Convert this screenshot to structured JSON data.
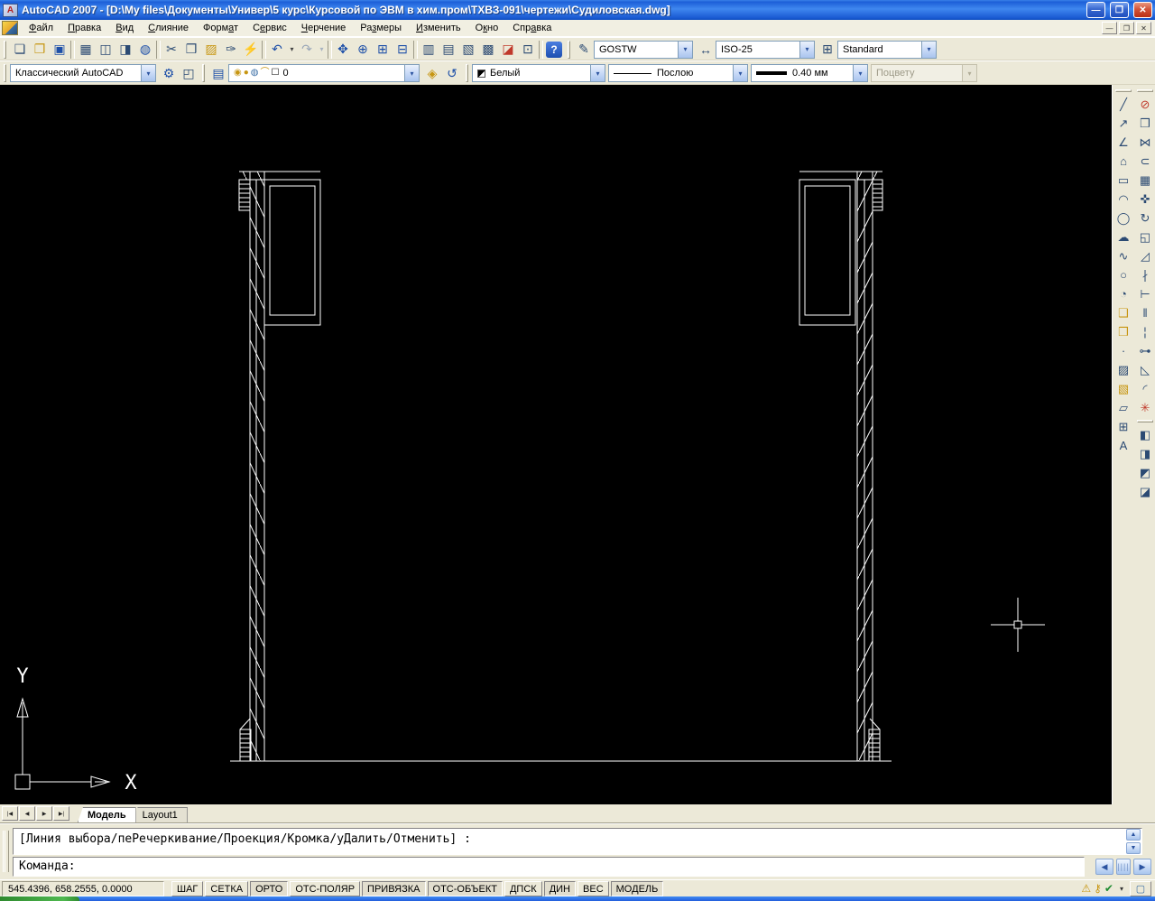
{
  "window": {
    "title": "AutoCAD 2007 - [D:\\My files\\Документы\\Универ\\5 курс\\Курсовой по ЭВМ в хим.пром\\ТХВЗ-091\\чертежи\\Судиловская.dwg]"
  },
  "controls": {
    "min": "—",
    "restore": "❐",
    "close": "✕"
  },
  "menu": {
    "items": [
      {
        "name": "menu-file",
        "label": "Файл",
        "u": 0
      },
      {
        "name": "menu-edit",
        "label": "Правка",
        "u": 0
      },
      {
        "name": "menu-view",
        "label": "Вид",
        "u": 0
      },
      {
        "name": "menu-merge",
        "label": "Слияние",
        "u": 0
      },
      {
        "name": "menu-format",
        "label": "Формат",
        "u": 4
      },
      {
        "name": "menu-tools",
        "label": "Сервис",
        "u": 1
      },
      {
        "name": "menu-draw",
        "label": "Черчение",
        "u": 0
      },
      {
        "name": "menu-dimension",
        "label": "Размеры",
        "u": 2
      },
      {
        "name": "menu-modify",
        "label": "Изменить",
        "u": 0
      },
      {
        "name": "menu-window",
        "label": "Окно",
        "u": 1
      },
      {
        "name": "menu-help",
        "label": "Справка",
        "u": 3
      }
    ]
  },
  "std": {
    "icons": [
      {
        "name": "new-icon",
        "g": "❏"
      },
      {
        "name": "open-icon",
        "g": "❐",
        "c": "y"
      },
      {
        "name": "save-icon",
        "g": "▣",
        "c": "b"
      },
      {
        "sep": true
      },
      {
        "name": "plot-icon",
        "g": "▦"
      },
      {
        "name": "plot-preview-icon",
        "g": "◫"
      },
      {
        "name": "publish-icon",
        "g": "◨"
      },
      {
        "name": "3d-dwf-icon",
        "g": "◍",
        "c": "b"
      },
      {
        "sep": true
      },
      {
        "name": "cut-icon",
        "g": "✂"
      },
      {
        "name": "copy-icon",
        "g": "❒"
      },
      {
        "name": "paste-icon",
        "g": "▨",
        "c": "y"
      },
      {
        "name": "match-properties-icon",
        "g": "✑"
      },
      {
        "name": "block-editor-icon",
        "g": "⚡",
        "c": "y"
      },
      {
        "sep": true
      },
      {
        "name": "undo-icon",
        "g": "↶",
        "c": "b"
      },
      {
        "name": "undo-dropdown-icon",
        "g": "▾",
        "c": "sm"
      },
      {
        "name": "redo-icon",
        "g": "↷",
        "c": "gr"
      },
      {
        "name": "redo-dropdown-icon",
        "g": "▾",
        "c": "smgr"
      },
      {
        "sep": true
      },
      {
        "name": "pan-icon",
        "g": "✥",
        "c": "b"
      },
      {
        "name": "zoom-realtime-icon",
        "g": "⊕",
        "c": "b"
      },
      {
        "name": "zoom-window-icon",
        "g": "⊞",
        "c": "b"
      },
      {
        "name": "zoom-previous-icon",
        "g": "⊟",
        "c": "b"
      },
      {
        "sep": true
      },
      {
        "name": "properties-icon",
        "g": "▥"
      },
      {
        "name": "designcenter-icon",
        "g": "▤"
      },
      {
        "name": "tool-palettes-icon",
        "g": "▧"
      },
      {
        "name": "sheet-set-manager-icon",
        "g": "▩"
      },
      {
        "name": "markup-set-manager-icon",
        "g": "◪",
        "c": "r"
      },
      {
        "name": "quickcalc-icon",
        "g": "⊡"
      },
      {
        "sep": true
      },
      {
        "name": "help-icon",
        "g": "?",
        "c": "help"
      }
    ]
  },
  "stylesbar": {
    "text_icon": "✎",
    "text_style": "GOSTW",
    "dim_icon": "↔",
    "dim_style": "ISO-25",
    "table_icon": "⊞",
    "table_style": "Standard"
  },
  "wsbar": {
    "value": "Классический AutoCAD",
    "gear_icon": "⚙",
    "save_icon": "◰"
  },
  "layersbar": {
    "manager_icon": "▤",
    "swatch_icons": [
      {
        "name": "layer-on-icon",
        "g": "◉",
        "c": "y"
      },
      {
        "name": "layer-thaw-icon",
        "g": "●",
        "c": "y"
      },
      {
        "name": "layer-vpfreeze-icon",
        "g": "◍",
        "c": "b"
      },
      {
        "name": "layer-lock-icon",
        "g": "⌒",
        "c": "y"
      },
      {
        "name": "layer-color-swatch",
        "g": "☐"
      }
    ],
    "value": "0",
    "make_current_icon": "◈",
    "previous_icon": "↺"
  },
  "propsbar": {
    "color_value": "Белый",
    "linetype_value": "Послою",
    "lineweight_value": "0.40 мм",
    "plotstyle_value": "Поцвету"
  },
  "draw": {
    "icons": [
      {
        "name": "line-icon",
        "g": "╱"
      },
      {
        "name": "construction-line-icon",
        "g": "↗"
      },
      {
        "name": "polyline-icon",
        "g": "∠"
      },
      {
        "name": "polygon-icon",
        "g": "⌂"
      },
      {
        "name": "rectangle-icon",
        "g": "▭"
      },
      {
        "name": "arc-icon",
        "g": "◠"
      },
      {
        "name": "circle-icon",
        "g": "◯"
      },
      {
        "name": "revision-cloud-icon",
        "g": "☁"
      },
      {
        "name": "spline-icon",
        "g": "∿"
      },
      {
        "name": "ellipse-icon",
        "g": "○"
      },
      {
        "name": "ellipse-arc-icon",
        "g": "◔"
      },
      {
        "name": "insert-block-icon",
        "g": "❑",
        "c": "y"
      },
      {
        "name": "make-block-icon",
        "g": "❒",
        "c": "y"
      },
      {
        "name": "point-icon",
        "g": "·"
      },
      {
        "name": "hatch-icon",
        "g": "▨"
      },
      {
        "name": "gradient-icon",
        "g": "▧",
        "c": "y"
      },
      {
        "name": "region-icon",
        "g": "▱"
      },
      {
        "name": "table-icon",
        "g": "⊞"
      },
      {
        "name": "multiline-text-icon",
        "g": "A"
      }
    ]
  },
  "modify": {
    "icons": [
      {
        "name": "erase-icon",
        "g": "⊘",
        "c": "r"
      },
      {
        "name": "copy-object-icon",
        "g": "❒"
      },
      {
        "name": "mirror-icon",
        "g": "⋈"
      },
      {
        "name": "offset-icon",
        "g": "⊂"
      },
      {
        "name": "array-icon",
        "g": "▦"
      },
      {
        "name": "move-icon",
        "g": "✜"
      },
      {
        "name": "rotate-icon",
        "g": "↻"
      },
      {
        "name": "scale-icon",
        "g": "◱"
      },
      {
        "name": "stretch-icon",
        "g": "◿"
      },
      {
        "name": "trim-icon",
        "g": "∤"
      },
      {
        "name": "extend-icon",
        "g": "⊢"
      },
      {
        "name": "break-icon",
        "g": "‖"
      },
      {
        "name": "break-at-point-icon",
        "g": "¦"
      },
      {
        "name": "join-icon",
        "g": "⊶"
      },
      {
        "name": "chamfer-icon",
        "g": "◺"
      },
      {
        "name": "fillet-icon",
        "g": "◜"
      },
      {
        "name": "explode-icon",
        "g": "✳",
        "c": "r"
      }
    ]
  },
  "draworder": {
    "icons": [
      {
        "name": "bring-to-front-icon",
        "g": "◧"
      },
      {
        "name": "send-to-back-icon",
        "g": "◨"
      },
      {
        "name": "bring-above-objects-icon",
        "g": "◩"
      },
      {
        "name": "send-under-objects-icon",
        "g": "◪"
      }
    ]
  },
  "tabs": {
    "nav": [
      {
        "name": "tab-first-button",
        "g": "|◀"
      },
      {
        "name": "tab-prev-button",
        "g": "◀"
      },
      {
        "name": "tab-next-button",
        "g": "▶"
      },
      {
        "name": "tab-last-button",
        "g": "▶|"
      }
    ],
    "model": "Модель",
    "layout1": "Layout1"
  },
  "command": {
    "history_line": "[Линия выбора/пеРечеркивание/Проекция/Кромка/уДалить/Отменить] :",
    "prompt": "Команда:",
    "scroll_up": "▲",
    "scroll_down": "▼",
    "left": "◀",
    "right": "▶",
    "grip": "||||"
  },
  "status": {
    "coords": "545.4396, 658.2555, 0.0000",
    "toggles": [
      {
        "name": "snap-toggle",
        "label": "ШАГ"
      },
      {
        "name": "grid-toggle",
        "label": "СЕТКА"
      },
      {
        "name": "ortho-toggle",
        "label": "ОРТО",
        "on": true
      },
      {
        "name": "polar-toggle",
        "label": "ОТС-ПОЛЯР"
      },
      {
        "name": "osnap-toggle",
        "label": "ПРИВЯЗКА",
        "on": true
      },
      {
        "name": "otrack-toggle",
        "label": "ОТС-ОБЪЕКТ",
        "on": true
      },
      {
        "name": "ducs-toggle",
        "label": "ДПСК"
      },
      {
        "name": "dyn-toggle",
        "label": "ДИН",
        "on": true
      },
      {
        "name": "lwt-toggle",
        "label": "ВЕС"
      },
      {
        "name": "model-toggle",
        "label": "МОДЕЛЬ",
        "on": true
      }
    ],
    "tray": [
      {
        "name": "communication-center-icon",
        "g": "⚠",
        "c": "y"
      },
      {
        "name": "toolbar-unlock-icon",
        "g": "⚷",
        "c": "y"
      },
      {
        "name": "trusted-dwg-icon",
        "g": "✔",
        "c": "g"
      }
    ],
    "tray_arrow": "▾",
    "clean_screen_icon": "▢"
  },
  "ucs": {
    "x": "X",
    "y": "Y"
  },
  "colors": {
    "titlebar_blue": "#1c5fd8",
    "ui_face": "#ECE9D8",
    "canvas_black": "#000000",
    "line_white": "#FFFFFF",
    "taskbar_blue": "#245EDC",
    "start_green": "#4fb84f"
  }
}
